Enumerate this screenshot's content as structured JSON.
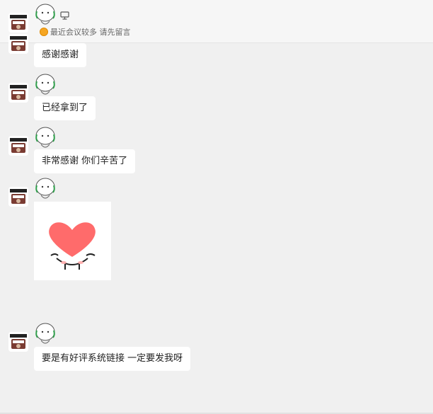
{
  "header": {
    "status_text": "最近会议较多 请先留言",
    "icons": {
      "device": "monitor-icon",
      "status": "busy-status-icon"
    }
  },
  "messages": [
    {
      "type": "text",
      "text": "感谢感谢"
    },
    {
      "type": "text",
      "text": "已经拿到了"
    },
    {
      "type": "text",
      "text": "非常感谢 你们辛苦了"
    },
    {
      "type": "sticker",
      "icon": "heart-sticker-icon"
    },
    {
      "type": "text",
      "text": "要是有好评系统链接 一定要发我呀"
    }
  ],
  "colors": {
    "chat_background": "#f0f0f0",
    "bubble": "#ffffff",
    "heart": "#ff6b6b",
    "busy": "#f5a623"
  }
}
